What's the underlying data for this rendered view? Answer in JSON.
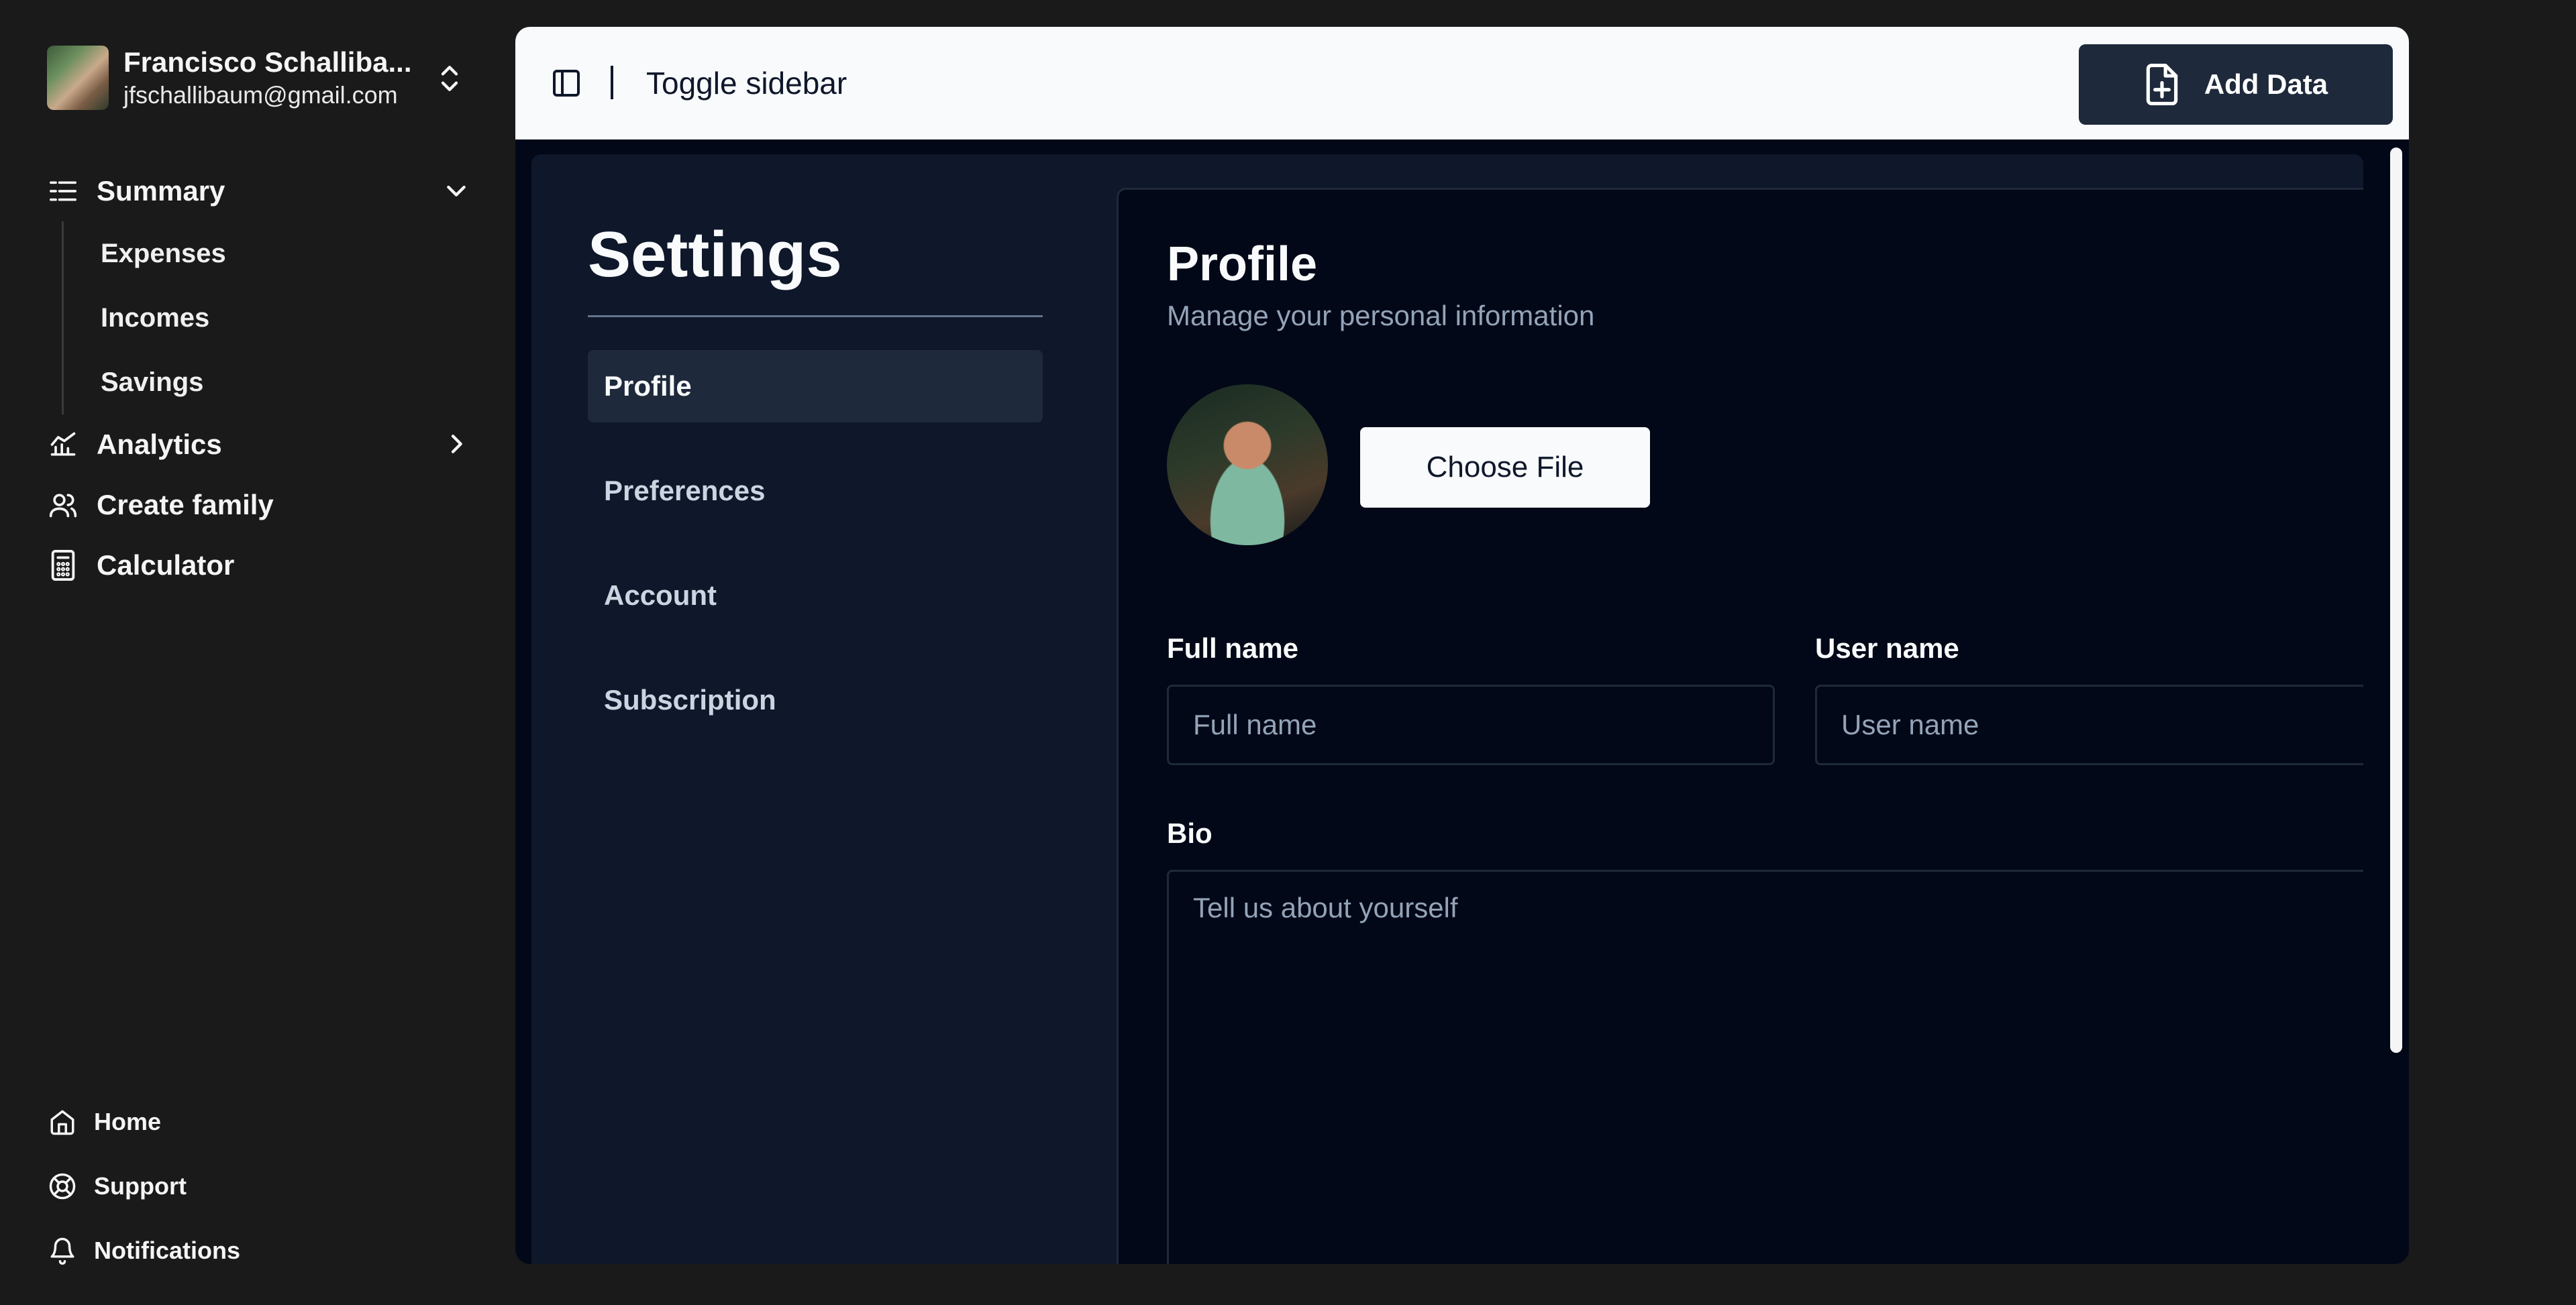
{
  "sidebar": {
    "user": {
      "name": "Francisco Schalliba...",
      "email": "jfschallibaum@gmail.com"
    },
    "nav": {
      "summary": "Summary",
      "sub": [
        "Expenses",
        "Incomes",
        "Savings"
      ],
      "analytics": "Analytics",
      "create_family": "Create family",
      "calculator": "Calculator"
    },
    "footer": {
      "home": "Home",
      "support": "Support",
      "notifications": "Notifications"
    }
  },
  "topbar": {
    "toggle_label": "Toggle sidebar",
    "add_data": "Add Data"
  },
  "settings": {
    "title": "Settings",
    "nav": [
      "Profile",
      "Preferences",
      "Account",
      "Subscription"
    ],
    "active_index": 0
  },
  "profile": {
    "title": "Profile",
    "subtitle": "Manage your personal information",
    "choose_file": "Choose File",
    "full_name_label": "Full name",
    "full_name_placeholder": "Full name",
    "user_name_label": "User name",
    "user_name_placeholder": "User name",
    "bio_label": "Bio",
    "bio_placeholder": "Tell us about yourself"
  }
}
